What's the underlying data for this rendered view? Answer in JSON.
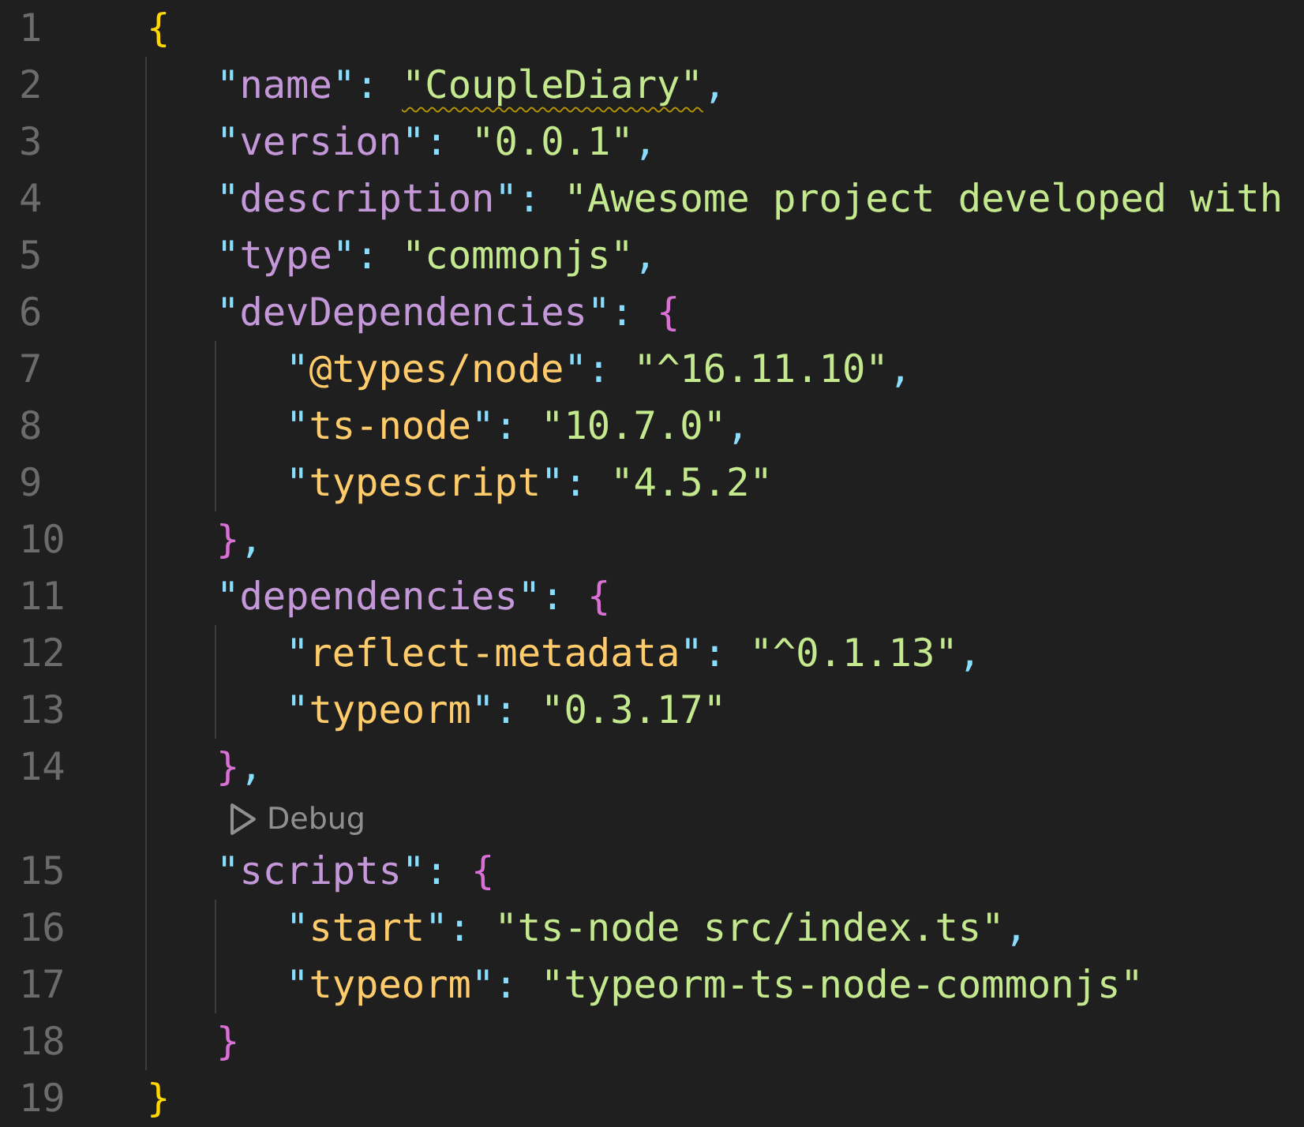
{
  "editor": {
    "lines": [
      {
        "kind": "code",
        "number": "1",
        "tokens": [
          {
            "kind": "brace",
            "text": "{"
          }
        ],
        "children": [
          {
            "kind": "code",
            "number": "2",
            "tokens": [
              {
                "kind": "punct",
                "text": "\""
              },
              {
                "kind": "key",
                "text": "name"
              },
              {
                "kind": "punct",
                "text": "\": "
              },
              {
                "kind": "string",
                "text": "\"CoupleDiary\"",
                "warning": true
              },
              {
                "kind": "punct",
                "text": ","
              }
            ]
          },
          {
            "kind": "code",
            "number": "3",
            "tokens": [
              {
                "kind": "punct",
                "text": "\""
              },
              {
                "kind": "key",
                "text": "version"
              },
              {
                "kind": "punct",
                "text": "\": "
              },
              {
                "kind": "string",
                "text": "\"0.0.1\"",
                "warning": false
              },
              {
                "kind": "punct",
                "text": ","
              }
            ]
          },
          {
            "kind": "code",
            "number": "4",
            "tokens": [
              {
                "kind": "punct",
                "text": "\""
              },
              {
                "kind": "key",
                "text": "description"
              },
              {
                "kind": "punct",
                "text": "\": "
              },
              {
                "kind": "string",
                "text": "\"Awesome project developed with",
                "warning": false
              }
            ]
          },
          {
            "kind": "code",
            "number": "5",
            "tokens": [
              {
                "kind": "punct",
                "text": "\""
              },
              {
                "kind": "key",
                "text": "type"
              },
              {
                "kind": "punct",
                "text": "\": "
              },
              {
                "kind": "string",
                "text": "\"commonjs\"",
                "warning": false
              },
              {
                "kind": "punct",
                "text": ","
              }
            ]
          },
          {
            "kind": "code",
            "number": "6",
            "tokens": [
              {
                "kind": "punct",
                "text": "\""
              },
              {
                "kind": "key",
                "text": "devDependencies"
              },
              {
                "kind": "punct",
                "text": "\": "
              },
              {
                "kind": "innerbrace",
                "text": "{"
              }
            ],
            "children": [
              {
                "kind": "code",
                "number": "7",
                "tokens": [
                  {
                    "kind": "punct",
                    "text": "\""
                  },
                  {
                    "kind": "subkey",
                    "text": "@types/node"
                  },
                  {
                    "kind": "punct",
                    "text": "\": "
                  },
                  {
                    "kind": "string",
                    "text": "\"^16.11.10\"",
                    "warning": false
                  },
                  {
                    "kind": "punct",
                    "text": ","
                  }
                ]
              },
              {
                "kind": "code",
                "number": "8",
                "tokens": [
                  {
                    "kind": "punct",
                    "text": "\""
                  },
                  {
                    "kind": "subkey",
                    "text": "ts-node"
                  },
                  {
                    "kind": "punct",
                    "text": "\": "
                  },
                  {
                    "kind": "string",
                    "text": "\"10.7.0\"",
                    "warning": false
                  },
                  {
                    "kind": "punct",
                    "text": ","
                  }
                ]
              },
              {
                "kind": "code",
                "number": "9",
                "tokens": [
                  {
                    "kind": "punct",
                    "text": "\""
                  },
                  {
                    "kind": "subkey",
                    "text": "typescript"
                  },
                  {
                    "kind": "punct",
                    "text": "\": "
                  },
                  {
                    "kind": "string",
                    "text": "\"4.5.2\"",
                    "warning": false
                  }
                ]
              }
            ]
          },
          {
            "kind": "code",
            "number": "10",
            "tokens": [
              {
                "kind": "innerbrace",
                "text": "}"
              },
              {
                "kind": "punct",
                "text": ","
              }
            ]
          },
          {
            "kind": "code",
            "number": "11",
            "tokens": [
              {
                "kind": "punct",
                "text": "\""
              },
              {
                "kind": "key",
                "text": "dependencies"
              },
              {
                "kind": "punct",
                "text": "\": "
              },
              {
                "kind": "innerbrace",
                "text": "{"
              }
            ],
            "children": [
              {
                "kind": "code",
                "number": "12",
                "tokens": [
                  {
                    "kind": "punct",
                    "text": "\""
                  },
                  {
                    "kind": "subkey",
                    "text": "reflect-metadata"
                  },
                  {
                    "kind": "punct",
                    "text": "\": "
                  },
                  {
                    "kind": "string",
                    "text": "\"^0.1.13\"",
                    "warning": false
                  },
                  {
                    "kind": "punct",
                    "text": ","
                  }
                ]
              },
              {
                "kind": "code",
                "number": "13",
                "tokens": [
                  {
                    "kind": "punct",
                    "text": "\""
                  },
                  {
                    "kind": "subkey",
                    "text": "typeorm"
                  },
                  {
                    "kind": "punct",
                    "text": "\": "
                  },
                  {
                    "kind": "string",
                    "text": "\"0.3.17\"",
                    "warning": false
                  }
                ]
              }
            ]
          },
          {
            "kind": "code",
            "number": "14",
            "tokens": [
              {
                "kind": "innerbrace",
                "text": "}"
              },
              {
                "kind": "punct",
                "text": ","
              }
            ]
          },
          {
            "kind": "codelens",
            "label": "Debug"
          },
          {
            "kind": "code",
            "number": "15",
            "tokens": [
              {
                "kind": "punct",
                "text": "\""
              },
              {
                "kind": "key",
                "text": "scripts"
              },
              {
                "kind": "punct",
                "text": "\": "
              },
              {
                "kind": "innerbrace",
                "text": "{"
              }
            ],
            "children": [
              {
                "kind": "code",
                "number": "16",
                "tokens": [
                  {
                    "kind": "punct",
                    "text": "\""
                  },
                  {
                    "kind": "subkey",
                    "text": "start"
                  },
                  {
                    "kind": "punct",
                    "text": "\": "
                  },
                  {
                    "kind": "string",
                    "text": "\"ts-node src/index.ts\"",
                    "warning": false
                  },
                  {
                    "kind": "punct",
                    "text": ","
                  }
                ]
              },
              {
                "kind": "code",
                "number": "17",
                "tokens": [
                  {
                    "kind": "punct",
                    "text": "\""
                  },
                  {
                    "kind": "subkey",
                    "text": "typeorm"
                  },
                  {
                    "kind": "punct",
                    "text": "\": "
                  },
                  {
                    "kind": "string",
                    "text": "\"typeorm-ts-node-commonjs\"",
                    "warning": false
                  }
                ]
              }
            ]
          },
          {
            "kind": "code",
            "number": "18",
            "tokens": [
              {
                "kind": "innerbrace",
                "text": "}"
              }
            ]
          }
        ]
      },
      {
        "kind": "code",
        "number": "19",
        "tokens": [
          {
            "kind": "brace",
            "text": "}"
          }
        ]
      }
    ]
  }
}
